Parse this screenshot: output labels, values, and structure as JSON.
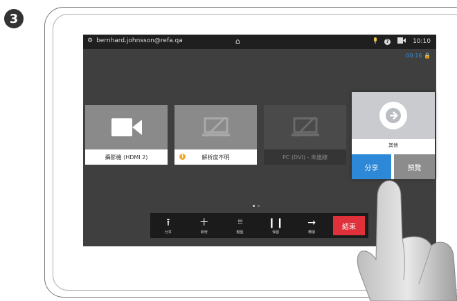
{
  "step_number": "3",
  "topbar": {
    "user": "bernhard.johnsson@refa.qa",
    "time": "10:10"
  },
  "call_timer": "00:16",
  "sources": [
    {
      "label": "攝影機 (HDMI 2)",
      "icon": "camera-icon"
    },
    {
      "label": "解析度不明",
      "icon": "no-signal-icon",
      "warning": "!"
    },
    {
      "label": "PC (DVI) - 未連線",
      "icon": "no-signal-icon"
    }
  ],
  "toolbar": {
    "share": "分享",
    "add": "新增",
    "keypad": "鍵盤",
    "hold": "保留",
    "transfer": "轉接",
    "end": "結束"
  },
  "panel": {
    "title": "其他",
    "share_button": "分享",
    "preview_button": "預覽"
  },
  "colors": {
    "accent": "#2d88d8",
    "end_call": "#e0303a",
    "warning": "#f2a72b"
  }
}
